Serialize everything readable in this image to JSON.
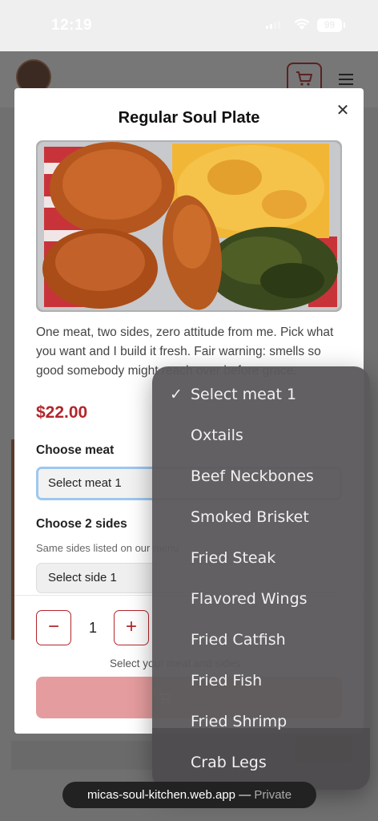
{
  "status_bar": {
    "time": "12:19",
    "battery": "99"
  },
  "site": {
    "url": "micas-soul-kitchen.web.app",
    "privacy": "Private"
  },
  "modal": {
    "title": "Regular Soul Plate",
    "description": "One meat, two sides, zero attitude from me. Pick what you want and I build it fresh. Fair warning: smells so good somebody might reach over before grace.",
    "price": "$22.00",
    "meat_label": "Choose meat",
    "meat_selected": "Select meat 1",
    "sides_label": "Choose 2 sides",
    "sides_hint": "Same sides listed on our menu",
    "side_selected": "Select side 1",
    "quantity": "1",
    "minus": "−",
    "plus": "+",
    "select_note": "Select your meat and sides"
  },
  "picker": {
    "checked_index": 0,
    "options": [
      "Select meat 1",
      "Oxtails",
      "Beef Neckbones",
      "Smoked Brisket",
      "Fried Steak",
      "Flavored Wings",
      "Fried Catfish",
      "Fried Fish",
      "Fried Shrimp",
      "Crab Legs"
    ]
  },
  "colors": {
    "accent": "#b3262b",
    "add_button": "#e59c9e",
    "picker_bg": "#5c5a5c"
  }
}
